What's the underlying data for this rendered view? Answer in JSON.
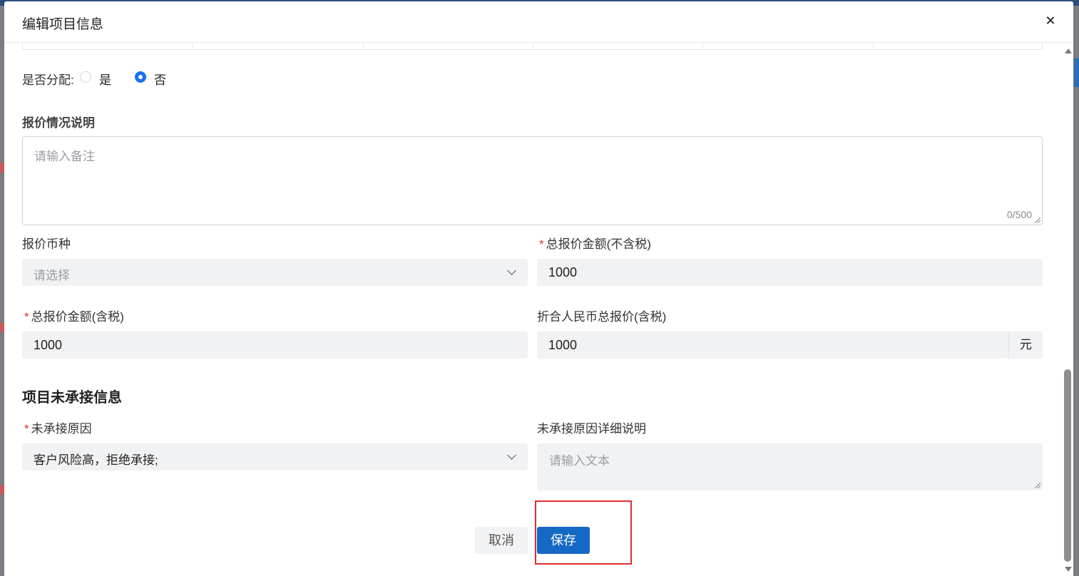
{
  "dialog": {
    "title": "编辑项目信息"
  },
  "allocation": {
    "label": "是否分配:",
    "options": [
      {
        "label": "是",
        "selected": false
      },
      {
        "label": "否",
        "selected": true
      }
    ]
  },
  "quote_desc": {
    "label": "报价情况说明",
    "placeholder": "请输入备注",
    "counter": "0/500"
  },
  "currency": {
    "label": "报价币种",
    "placeholder": "请选择"
  },
  "total_excl_tax": {
    "label": "总报价金额(不含税)",
    "value": "1000",
    "required": true
  },
  "total_incl_tax": {
    "label": "总报价金额(含税)",
    "value": "1000",
    "required": true
  },
  "rmb_total": {
    "label": "折合人民币总报价(含税)",
    "value": "1000",
    "suffix": "元"
  },
  "section": {
    "title": "项目未承接信息"
  },
  "reason": {
    "label": "未承接原因",
    "value": "客户风险高，拒绝承接;",
    "required": true
  },
  "reason_detail": {
    "label": "未承接原因详细说明",
    "placeholder": "请输入文本"
  },
  "footer": {
    "cancel_label": "取消",
    "save_label": "保存"
  },
  "colors": {
    "primary": "#1668c5",
    "radio_selected": "#1a73e8",
    "required_star": "#e5322d",
    "highlight_box": "#e52b2b"
  },
  "icons": [
    "close-icon",
    "chevron-down-icon",
    "resize-handle-icon",
    "scroll-up-icon",
    "scroll-down-icon"
  ]
}
